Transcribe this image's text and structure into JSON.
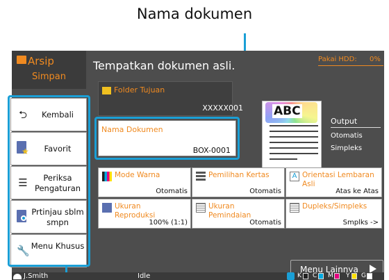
{
  "callout": {
    "title": "Nama dokumen"
  },
  "app": {
    "title": "Arsip",
    "subtitle": "Simpan",
    "accent_color": "#f08a20",
    "highlight_color": "#1a9fd6"
  },
  "header": {
    "message": "Tempatkan dokumen asli.",
    "hdd_label": "Pakai HDD:",
    "hdd_value": "0%"
  },
  "sidebar": {
    "items": [
      {
        "label": "Kembali",
        "icon": "back-arrow-icon"
      },
      {
        "label": "Favorit",
        "icon": "favorite-doc-icon"
      },
      {
        "label": "Periksa Pengaturan",
        "icon": "list-icon"
      },
      {
        "label": "Prtinjau sblm smpn",
        "icon": "preview-magnifier-icon"
      },
      {
        "label": "Menu Khusus",
        "icon": "wrench-icon"
      }
    ]
  },
  "destination": {
    "label": "Folder Tujuan",
    "value": "XXXXX001"
  },
  "document_name": {
    "label": "Nama Dokumen",
    "value": "BOX-0001"
  },
  "preview": {
    "sample_text": "ABC"
  },
  "output": {
    "label": "Output",
    "value1": "Otomatis",
    "value2": "Simpleks"
  },
  "tiles": [
    {
      "label": "Mode Warna",
      "value": "Otomatis",
      "icon": "color-mode-icon"
    },
    {
      "label": "Pemilihan Kertas",
      "value": "Otomatis",
      "icon": "paper-tray-icon"
    },
    {
      "label": "Orientasi Lembaran Asli",
      "value": "Atas ke Atas",
      "icon": "orientation-icon"
    },
    {
      "label": "Ukuran Reproduksi",
      "value": "100% (1:1)",
      "icon": "reproduction-size-icon"
    },
    {
      "label": "Ukuran Pemindaian",
      "value": "Otomatis",
      "icon": "scan-size-icon"
    },
    {
      "label": "Dupleks/Simpleks",
      "value": "Smplks ->",
      "icon": "duplex-icon"
    }
  ],
  "more_menu": {
    "label": "Menu Lainnya"
  },
  "status": {
    "user": "J.Smith",
    "state": "Idle",
    "inks": [
      {
        "label": "K",
        "color": "#222222"
      },
      {
        "label": "C",
        "color": "#00a9e0"
      },
      {
        "label": "M",
        "color": "#e4007f"
      },
      {
        "label": "Y",
        "color": "#ffe100"
      },
      {
        "label": "G",
        "color": "#ffffff"
      }
    ]
  }
}
